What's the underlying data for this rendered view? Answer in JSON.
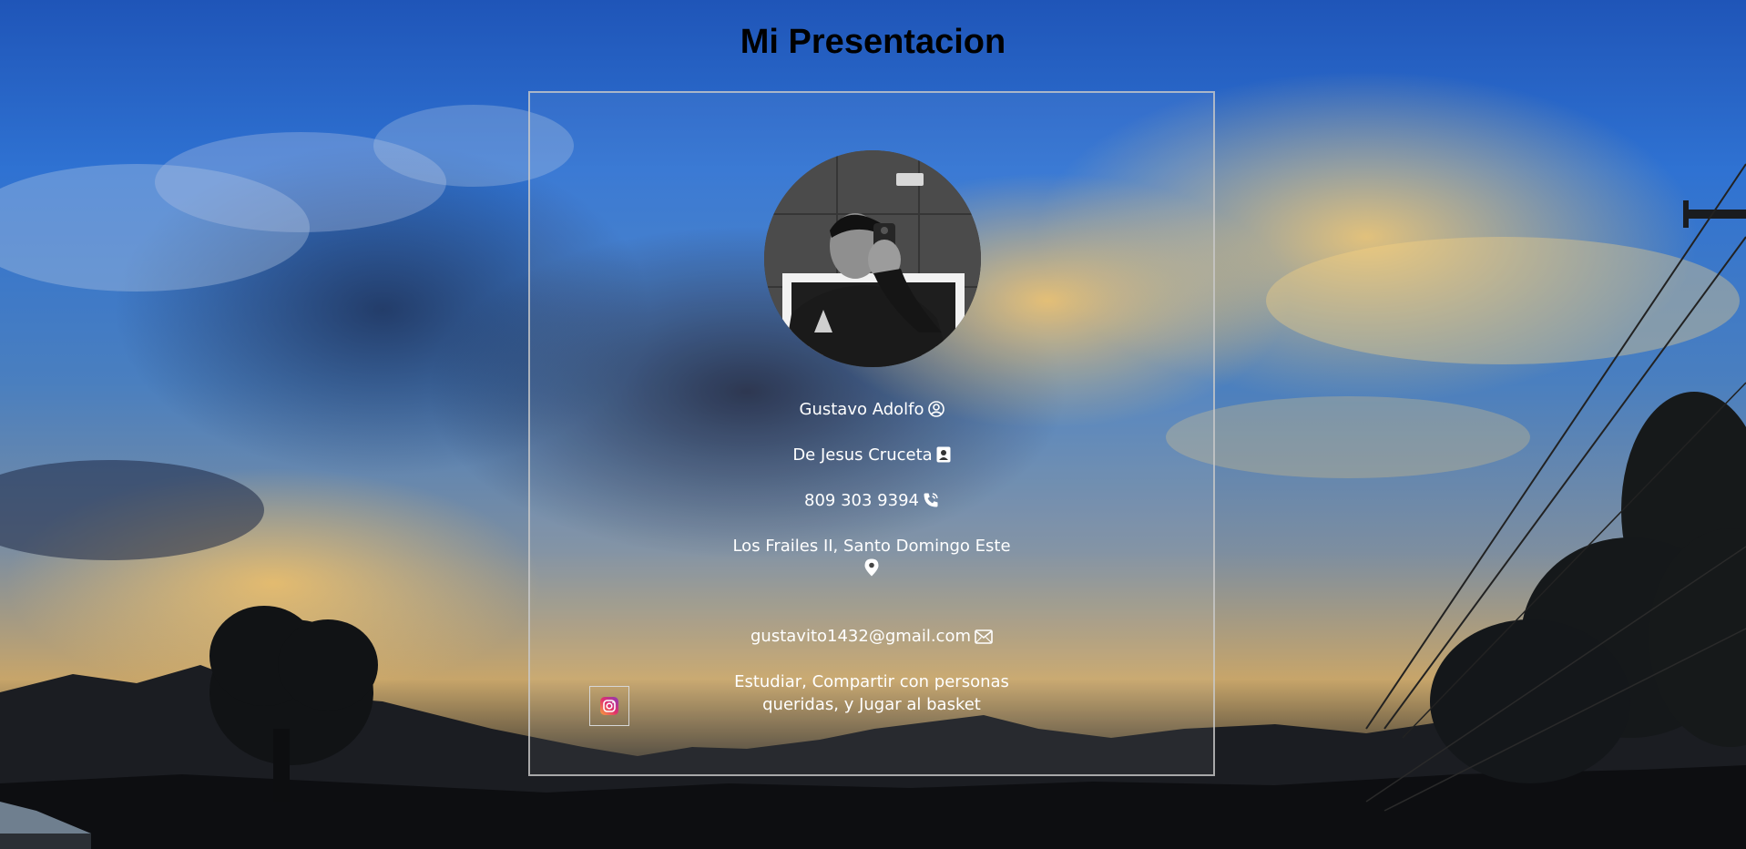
{
  "page": {
    "title": "Mi Presentacion"
  },
  "profile": {
    "first_name": "Gustavo Adolfo",
    "last_name": "De Jesus Cruceta",
    "phone": "809 303 9394",
    "address": "Los Frailes II, Santo Domingo Este",
    "email": "gustavito1432@gmail.com",
    "hobbies_line1": "Estudiar, Compartir con personas",
    "hobbies_line2": "queridas, y Jugar al basket"
  },
  "icons": {
    "first_name": "user-circle-icon",
    "last_name": "contact-card-icon",
    "phone": "phone-icon",
    "address": "map-pin-icon",
    "email": "envelope-icon",
    "social": "instagram-icon"
  },
  "colors": {
    "text": "#ffffff",
    "title": "#000000",
    "card_border": "#c8c8c8",
    "instagram_start": "#f9a13b",
    "instagram_end": "#c1359b"
  }
}
